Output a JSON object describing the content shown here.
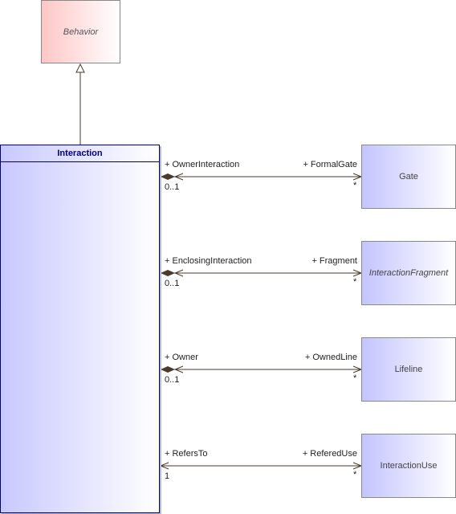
{
  "diagram": {
    "general": {
      "name": "Behavior",
      "abstract": true,
      "color": "#ffc6c6"
    },
    "main": {
      "name": "Interaction",
      "color": "#000080"
    },
    "associations": [
      {
        "source_role": "+ OwnerInteraction",
        "source_mult": "0..1",
        "target_role": "+ FormalGate",
        "target_mult": "*",
        "target": "Gate",
        "target_abstract": false,
        "composite": true
      },
      {
        "source_role": "+ EnclosingInteraction",
        "source_mult": "0..1",
        "target_role": "+ Fragment",
        "target_mult": "*",
        "target": "InteractionFragment",
        "target_abstract": true,
        "composite": true
      },
      {
        "source_role": "+ Owner",
        "source_mult": "0..1",
        "target_role": "+ OwnedLine",
        "target_mult": "*",
        "target": "Lifeline",
        "target_abstract": false,
        "composite": true
      },
      {
        "source_role": "+ RefersTo",
        "source_mult": "1",
        "target_role": "+ ReferedUse",
        "target_mult": "*",
        "target": "InteractionUse",
        "target_abstract": false,
        "composite": false
      }
    ]
  }
}
